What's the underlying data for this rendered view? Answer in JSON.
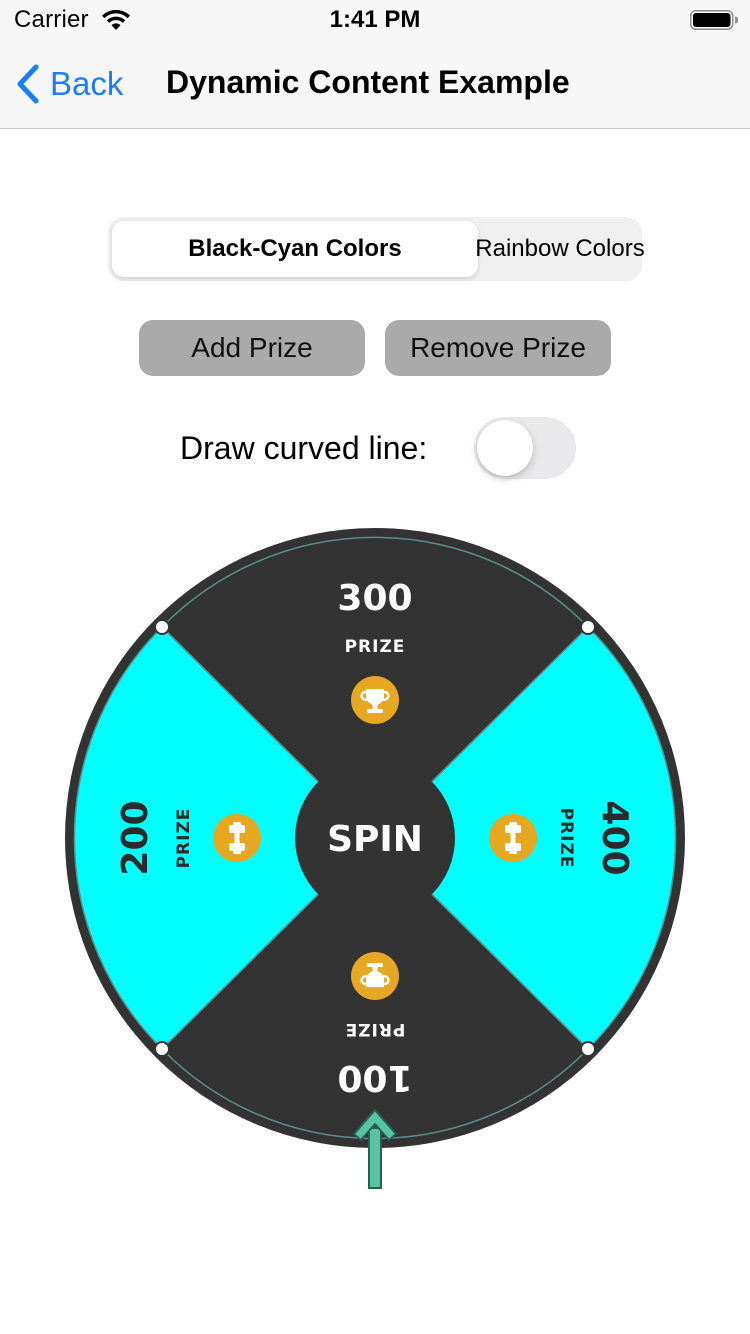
{
  "status_bar": {
    "carrier": "Carrier",
    "time": "1:41 PM",
    "wifi_icon": "wifi-icon",
    "battery_icon": "battery-icon"
  },
  "nav": {
    "back_label": "Back",
    "back_icon": "chevron-left-icon",
    "title": "Dynamic Content Example",
    "accent": "#1a7ef6"
  },
  "color_mode": {
    "segments": [
      "Black-Cyan Colors",
      "Rainbow Colors"
    ],
    "selected_index": 0
  },
  "actions": {
    "add_label": "Add Prize",
    "remove_label": "Remove Prize"
  },
  "curved_line": {
    "label": "Draw curved line:",
    "enabled": false
  },
  "wheel": {
    "center_label": "SPIN",
    "dark_color": "#333333",
    "cyan_color": "#00ffff",
    "badge_color": "#e6a820",
    "pointer_color": "#58c4a4",
    "slices": [
      {
        "amount": "300",
        "caption": "PRIZE",
        "icon": "trophy-icon",
        "color": "#333333",
        "text_color": "#ffffff"
      },
      {
        "amount": "400",
        "caption": "PRIZE",
        "icon": "dumbbell-icon",
        "color": "#00ffff",
        "text_color": "#2b2b2b"
      },
      {
        "amount": "100",
        "caption": "PRIZE",
        "icon": "trophy-icon",
        "color": "#333333",
        "text_color": "#ffffff"
      },
      {
        "amount": "200",
        "caption": "PRIZE",
        "icon": "dumbbell-icon",
        "color": "#00ffff",
        "text_color": "#2b2b2b"
      }
    ]
  }
}
